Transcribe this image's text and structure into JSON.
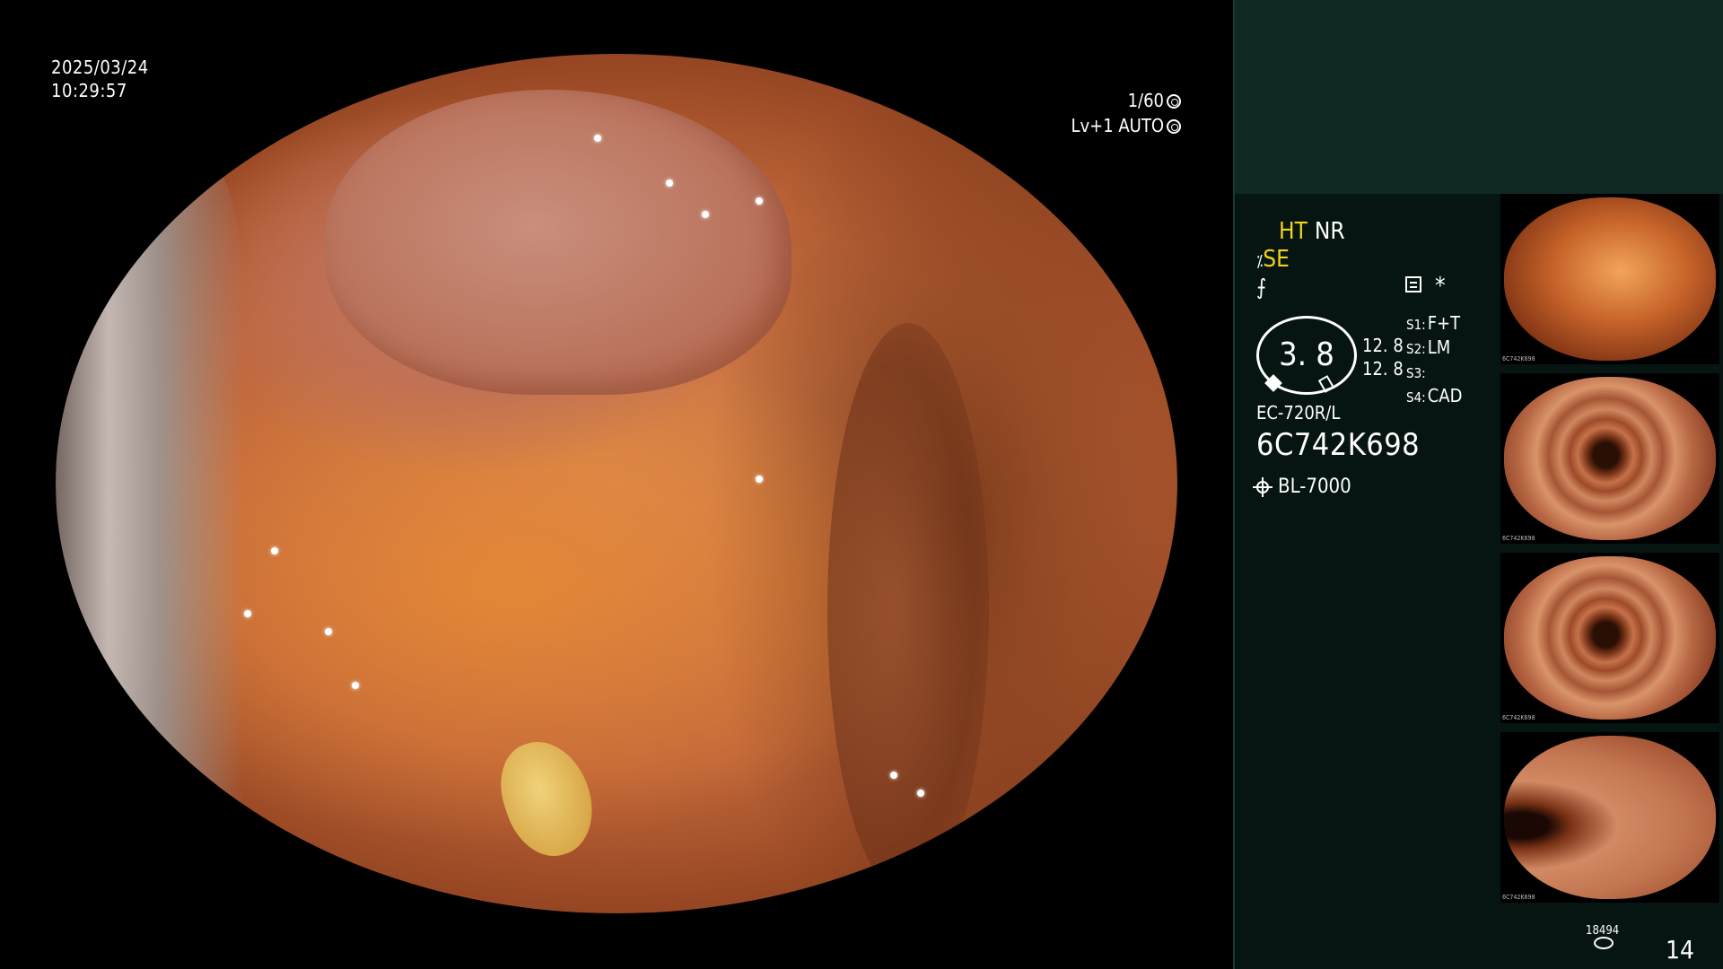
{
  "overlay": {
    "date": "2025/03/24",
    "time": "10:29:57",
    "shutter": "1/60",
    "level": "Lv+1",
    "iris": "AUTO"
  },
  "panel": {
    "mode_ht": "HT",
    "mode_nr": "NR",
    "mode_se": "SE",
    "mode_sub_glyph": "⨍",
    "star": "*",
    "gauge_value": "3. 8",
    "gauge_nums": [
      "12. 8",
      "12. 8"
    ],
    "s_keys": [
      "S1:",
      "S2:",
      "S3:",
      "S4:"
    ],
    "s_vals": [
      "F+T",
      "LM",
      "",
      "CAD"
    ],
    "scope_model": "EC-720R/L",
    "scope_serial": "6C742K698",
    "lamp": "BL-7000"
  },
  "thumbnails": [
    {
      "label": "6C742K698"
    },
    {
      "label": "6C742K698"
    },
    {
      "label": "6C742K698"
    },
    {
      "label": "6C742K698"
    }
  ],
  "footer": {
    "count_small": "18494",
    "count_big": "14"
  },
  "colors": {
    "accent_yellow": "#f2d21c",
    "panel_top": "#0f2a25",
    "panel_body": "#071512"
  }
}
